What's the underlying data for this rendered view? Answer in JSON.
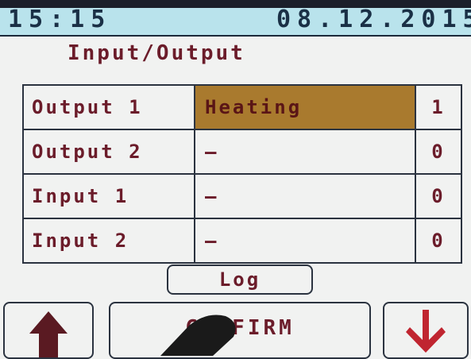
{
  "status_bar": {
    "time": "15:15",
    "date": "08.12.2015"
  },
  "screen": {
    "title": "Input/Output"
  },
  "io_table": {
    "rows": [
      {
        "name": "Output 1",
        "function": "Heating",
        "state": "1",
        "selected": true
      },
      {
        "name": "Output 2",
        "function": "—",
        "state": "0",
        "selected": false
      },
      {
        "name": "Input 1",
        "function": "—",
        "state": "0",
        "selected": false
      },
      {
        "name": "Input 2",
        "function": "—",
        "state": "0",
        "selected": false
      }
    ]
  },
  "buttons": {
    "log": "Log",
    "confirm": "CONFIRM",
    "up_icon": "arrow-up-icon",
    "down_icon": "arrow-down-icon"
  },
  "colors": {
    "header_bg": "#b9e3ec",
    "header_text": "#1a3046",
    "text": "#6b1c2a",
    "selected_cell": "#a97a2e",
    "up_arrow": "#5a1a22",
    "down_arrow": "#c02530"
  }
}
